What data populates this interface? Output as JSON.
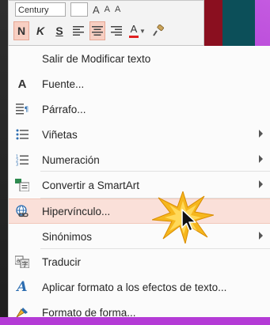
{
  "toolbar": {
    "font_name": "Century",
    "bold_label": "N",
    "italic_label": "K",
    "underline_label": "S",
    "font_color_label": "A",
    "font_color": "#e02020",
    "icons": [
      "align-left-icon",
      "align-center-icon",
      "align-right-icon",
      "font-color-icon",
      "format-painter-icon"
    ]
  },
  "menu": {
    "items": [
      {
        "label": "Salir de Modificar texto",
        "icon": ""
      },
      {
        "label": "Fuente...",
        "icon": "font-icon"
      },
      {
        "label": "Párrafo...",
        "icon": "paragraph-icon"
      },
      {
        "label": "Viñetas",
        "icon": "bullets-icon",
        "submenu": true
      },
      {
        "label": "Numeración",
        "icon": "numbering-icon",
        "submenu": true
      },
      {
        "label": "Convertir a SmartArt",
        "icon": "smartart-icon",
        "submenu": true
      },
      {
        "label": "Hipervínculo...",
        "icon": "hyperlink-icon",
        "highlighted": true
      },
      {
        "label": "Sinónimos",
        "icon": "",
        "submenu": true
      },
      {
        "label": "Traducir",
        "icon": "translate-icon"
      },
      {
        "label": "Aplicar formato a los efectos de texto...",
        "icon": "text-effects-icon"
      },
      {
        "label": "Formato de forma...",
        "icon": "format-shape-icon"
      }
    ]
  },
  "colors": {
    "background": "#b43bd6",
    "hover": "#fae0d9",
    "active_button": "#f8cfc2"
  }
}
